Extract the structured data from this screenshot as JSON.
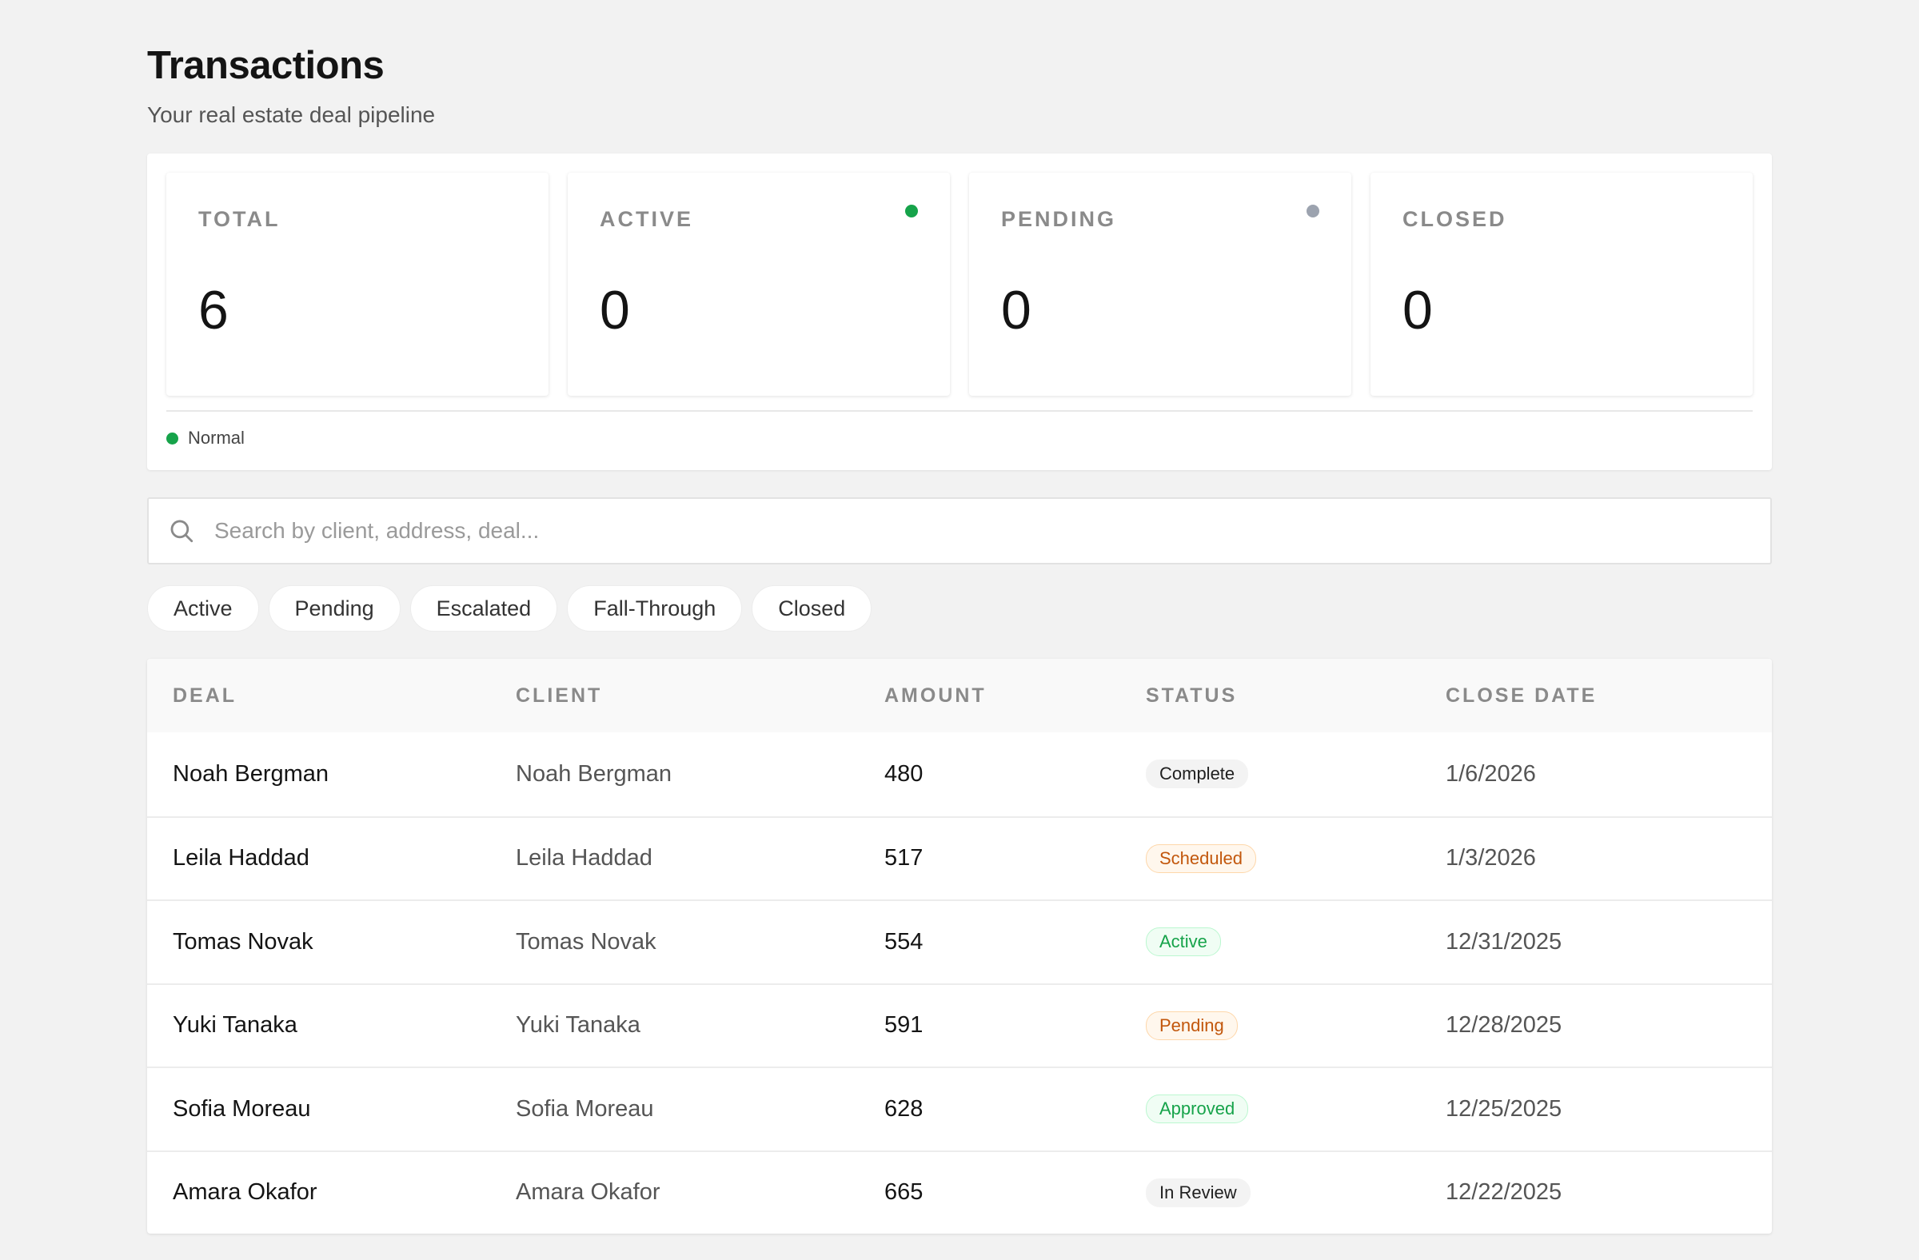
{
  "header": {
    "title": "Transactions",
    "subtitle": "Your real estate deal pipeline"
  },
  "stats": [
    {
      "label": "TOTAL",
      "value": "6",
      "dot_color": null
    },
    {
      "label": "ACTIVE",
      "value": "0",
      "dot_color": "#16a34a"
    },
    {
      "label": "PENDING",
      "value": "0",
      "dot_color": "#9ca3af"
    },
    {
      "label": "CLOSED",
      "value": "0",
      "dot_color": null
    }
  ],
  "legend": {
    "label": "Normal",
    "color": "#16a34a"
  },
  "search": {
    "placeholder": "Search by client, address, deal...",
    "value": ""
  },
  "filters": [
    "Active",
    "Pending",
    "Escalated",
    "Fall-Through",
    "Closed"
  ],
  "table": {
    "columns": [
      "DEAL",
      "CLIENT",
      "AMOUNT",
      "STATUS",
      "CLOSE DATE"
    ],
    "rows": [
      {
        "deal": "Noah Bergman",
        "client": "Noah Bergman",
        "amount": "480",
        "status": "Complete",
        "status_style": "neutral",
        "close_date": "1/6/2026"
      },
      {
        "deal": "Leila Haddad",
        "client": "Leila Haddad",
        "amount": "517",
        "status": "Scheduled",
        "status_style": "warning",
        "close_date": "1/3/2026"
      },
      {
        "deal": "Tomas Novak",
        "client": "Tomas Novak",
        "amount": "554",
        "status": "Active",
        "status_style": "success",
        "close_date": "12/31/2025"
      },
      {
        "deal": "Yuki Tanaka",
        "client": "Yuki Tanaka",
        "amount": "591",
        "status": "Pending",
        "status_style": "warning",
        "close_date": "12/28/2025"
      },
      {
        "deal": "Sofia Moreau",
        "client": "Sofia Moreau",
        "amount": "628",
        "status": "Approved",
        "status_style": "success",
        "close_date": "12/25/2025"
      },
      {
        "deal": "Amara Okafor",
        "client": "Amara Okafor",
        "amount": "665",
        "status": "In Review",
        "status_style": "neutral",
        "close_date": "12/22/2025"
      }
    ]
  },
  "colors": {
    "page_bg": "#f2f2f2",
    "success_text": "#16a34a",
    "success_bg": "#f0fdf4",
    "success_border": "#bbf7d0",
    "warning_text": "#c2570c",
    "warning_bg": "#fff7ed",
    "warning_border": "#fed7aa",
    "neutral_text": "#1f1f1f",
    "neutral_bg": "#f3f3f3",
    "neutral_border": "#f3f3f3"
  }
}
